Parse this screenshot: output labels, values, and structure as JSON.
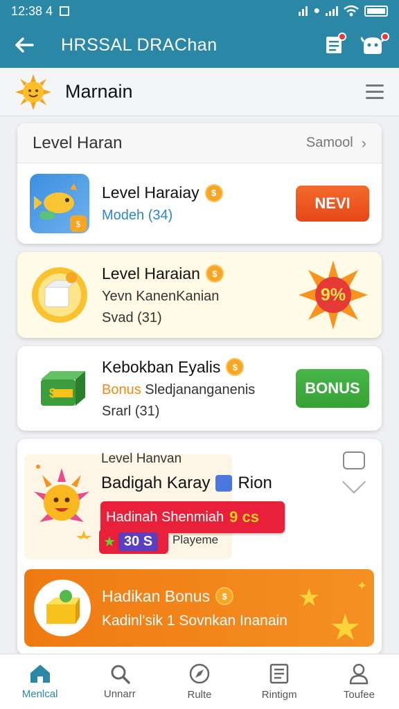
{
  "status": {
    "time": "12:38 4"
  },
  "app_bar": {
    "title": "HRSSAL DRAChan"
  },
  "subheader": {
    "title": "Marnain"
  },
  "section": {
    "title": "Level Haran",
    "more": "Samool"
  },
  "items": [
    {
      "title": "Level Haraiay",
      "coin": "$",
      "subtitle": "Modeh (34)",
      "button": "NEVI",
      "button_color": "#f0531c"
    },
    {
      "title": "Level Haraian",
      "coin": "$",
      "subtitle": "Yevn KanenKanian",
      "detail": "Svad (31)",
      "badge": "9%"
    },
    {
      "title": "Kebokban Eyalis",
      "coin": "$",
      "subtitle_accent": "Bonus",
      "subtitle": "Sledjananganenis",
      "detail": "Srarl (31)",
      "button": "BONUS",
      "button_color": "#3ba63b"
    }
  ],
  "feature": {
    "kicker": "Level Hanvan",
    "title": "Badigah Karay",
    "title_tag": "Rion",
    "banner": "Hadinah Shenmiah",
    "banner_badge": "9 cs",
    "chip": "30 S",
    "chip_note": "Playeme"
  },
  "promo": {
    "title": "Hadikan Bonus",
    "coin": "$",
    "subtitle": "Kadinl'sik 1 Sovnkan Inanain"
  },
  "nav": [
    {
      "label": "Menlcal",
      "icon": "home-icon"
    },
    {
      "label": "Unnarr",
      "icon": "search-icon"
    },
    {
      "label": "Rulte",
      "icon": "compass-icon"
    },
    {
      "label": "Rintigm",
      "icon": "list-icon"
    },
    {
      "label": "Toufee",
      "icon": "profile-icon"
    }
  ],
  "colors": {
    "brand": "#2b87a6",
    "accent_orange": "#f0531c",
    "accent_green": "#3ba63b",
    "badge_red": "#e53935"
  }
}
